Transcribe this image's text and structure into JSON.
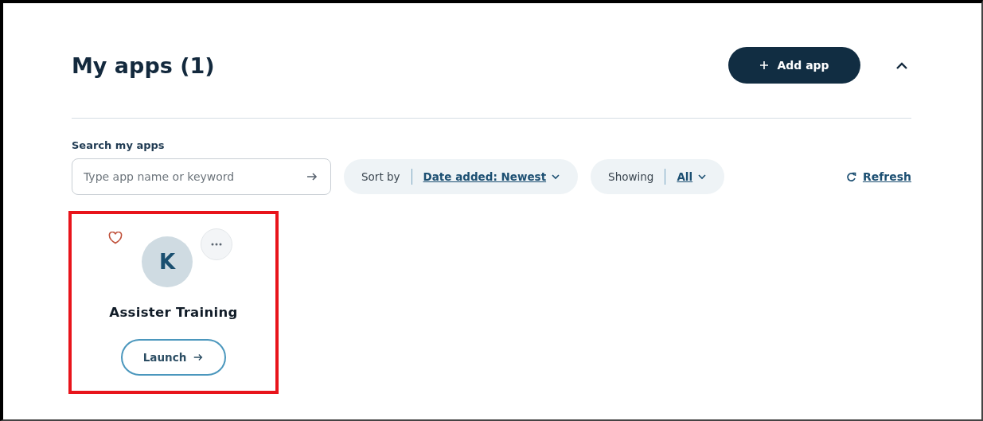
{
  "section": {
    "title": "My apps (1)",
    "add_button": "Add app",
    "expanded": true
  },
  "search": {
    "label": "Search my apps",
    "placeholder": "Type app name or keyword"
  },
  "sort": {
    "label": "Sort by",
    "value": "Date added: Newest"
  },
  "filter": {
    "label": "Showing",
    "value": "All"
  },
  "refresh": "Refresh",
  "apps": [
    {
      "initial": "K",
      "name": "Assister Training",
      "favorite": false,
      "highlighted": true,
      "launch": "Launch"
    }
  ]
}
